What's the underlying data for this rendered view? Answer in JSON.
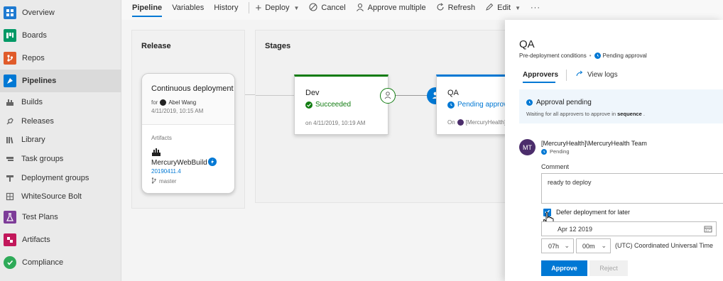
{
  "sidebar": {
    "items": [
      {
        "label": "Overview",
        "icon": "overview-icon",
        "color": "#1e7ad1"
      },
      {
        "label": "Boards",
        "icon": "boards-icon",
        "color": "#009966"
      },
      {
        "label": "Repos",
        "icon": "repos-icon",
        "color": "#e05b2a"
      },
      {
        "label": "Pipelines",
        "icon": "pipelines-icon",
        "color": "#0078d4"
      },
      {
        "label": "Builds",
        "icon": "builds-icon",
        "color": "#555555"
      },
      {
        "label": "Releases",
        "icon": "releases-icon",
        "color": "#555555"
      },
      {
        "label": "Library",
        "icon": "library-icon",
        "color": "#555555"
      },
      {
        "label": "Task groups",
        "icon": "task-groups-icon",
        "color": "#555555"
      },
      {
        "label": "Deployment groups",
        "icon": "deployment-groups-icon",
        "color": "#555555"
      },
      {
        "label": "WhiteSource Bolt",
        "icon": "whitesource-icon",
        "color": "#555555"
      },
      {
        "label": "Test Plans",
        "icon": "test-plans-icon",
        "color": "#7d3c98"
      },
      {
        "label": "Artifacts",
        "icon": "artifacts-icon",
        "color": "#c2185b"
      },
      {
        "label": "Compliance",
        "icon": "compliance-icon",
        "color": "#2eaa58"
      }
    ]
  },
  "toolbar": {
    "tabs": [
      "Pipeline",
      "Variables",
      "History"
    ],
    "deploy": "Deploy",
    "cancel": "Cancel",
    "approve_multiple": "Approve multiple",
    "refresh": "Refresh",
    "edit": "Edit",
    "more": "···"
  },
  "release": {
    "title": "Release",
    "trigger": "Continuous deployment",
    "for_label": "for",
    "user": "Abel Wang",
    "datetime": "4/11/2019, 10:15 AM",
    "artifacts_label": "Artifacts",
    "artifact_name": "MercuryWebBuild",
    "artifact_version": "20190411.4",
    "branch": "master"
  },
  "stages": {
    "title": "Stages",
    "dev": {
      "name": "Dev",
      "status": "Succeeded",
      "date": "on 4/11/2019, 10:19 AM"
    },
    "qa": {
      "name": "QA",
      "status": "Pending approval",
      "on_label": "On",
      "approver": "[MercuryHealth]"
    }
  },
  "pane": {
    "title": "QA",
    "subtitle": "Pre-deployment conditions",
    "subtitle_sep": "•",
    "subtitle_status": "Pending approval",
    "tab_approvers": "Approvers",
    "tab_logs": "View logs",
    "banner_title": "Approval pending",
    "banner_text_pre": "Waiting for all approvers to approve in",
    "banner_text_bold": "sequence",
    "banner_text_post": ".",
    "approver_initials": "MT",
    "approver_name": "[MercuryHealth]\\MercuryHealth Team",
    "approver_status": "Pending",
    "comment_label": "Comment",
    "comment_value": "ready to deploy",
    "defer_label": "Defer deployment for later",
    "defer_checked": true,
    "date_value": "Apr 12 2019",
    "hour_value": "07h",
    "minute_value": "00m",
    "timezone": "(UTC) Coordinated Universal Time",
    "approve_label": "Approve",
    "reject_label": "Reject"
  },
  "colors": {
    "accent": "#0078d4",
    "success": "#107c10",
    "avatar": "#4b2d6b"
  }
}
